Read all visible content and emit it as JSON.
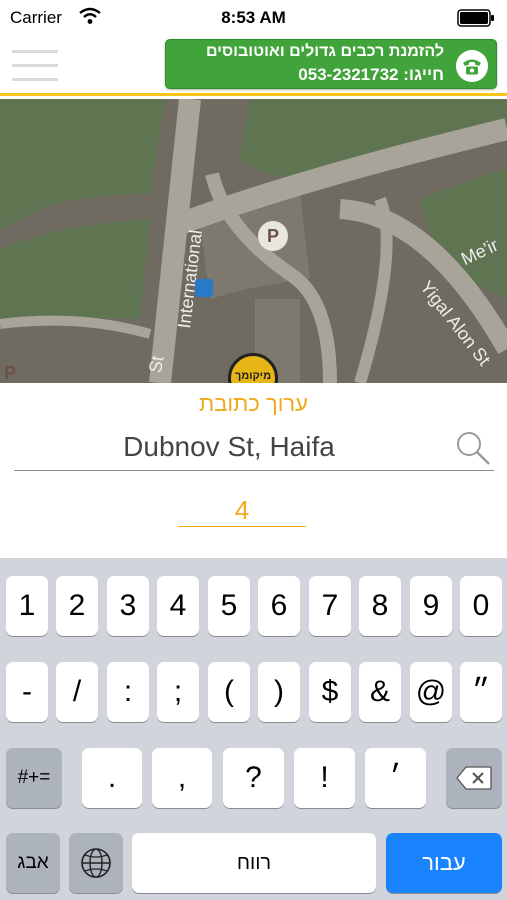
{
  "status_bar": {
    "carrier": "Carrier",
    "time": "8:53 AM",
    "icons": [
      "wifi-icon",
      "battery-icon"
    ]
  },
  "header": {
    "menu_icon": "hamburger-menu-icon",
    "promo": {
      "line1": "להזמנת רכבים גדולים ואוטובוסים",
      "line2": "חייגו: 053-2321732",
      "icon": "phone-icon",
      "color": "#40a43a"
    }
  },
  "map": {
    "labels": {
      "international": "International",
      "meir": "Me'ir",
      "yigal_alon": "Yigal Alon St",
      "st": "St"
    },
    "parking": "P",
    "pin_label": "מיקומך"
  },
  "form": {
    "title": "ערוך כתובת",
    "address_value": "Dubnov St, Haifa",
    "house_number": "4",
    "accent_color": "#f0a81c"
  },
  "keyboard": {
    "row1": [
      "1",
      "2",
      "3",
      "4",
      "5",
      "6",
      "7",
      "8",
      "9",
      "0"
    ],
    "row2": [
      "-",
      "/",
      ":",
      ";",
      "(",
      ")",
      "$",
      "&",
      "@",
      "״"
    ],
    "row3": [
      "#+=",
      ".",
      ",",
      "?",
      "!",
      "׳"
    ],
    "row4": {
      "letters": "אבג",
      "space": "רווח",
      "go": "עבור"
    },
    "go_color": "#1a84ff"
  }
}
